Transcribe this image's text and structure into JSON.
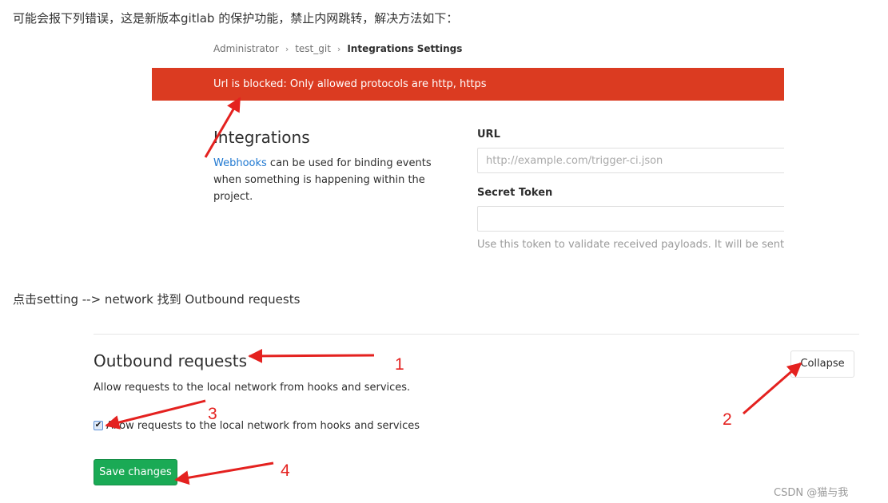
{
  "intro_text": "可能会报下列错误，这是新版本gitlab 的保护功能，禁止内网跳转，解决方法如下：",
  "screenshot1": {
    "breadcrumb": [
      {
        "label": "Administrator"
      },
      {
        "label": "test_git"
      },
      {
        "label": "Integrations Settings"
      }
    ],
    "error_flash": "Url is blocked: Only allowed protocols are http, https",
    "integrations": {
      "title": "Integrations",
      "link": "Webhooks",
      "description": " can be used for binding events when something is happening within the project."
    },
    "url_label": "URL",
    "url_placeholder": "http://example.com/trigger-ci.json",
    "secret_label": "Secret Token",
    "secret_value": "",
    "secret_help": "Use this token to validate received payloads. It will be sent with"
  },
  "step_text": "点击setting --> network 找到 Outbound requests",
  "outbound": {
    "title": "Outbound requests",
    "description": "Allow requests to the local network from hooks and services.",
    "collapse_label": "Collapse",
    "checkbox_checked": true,
    "checkbox_label": "Allow requests to the local network from hooks and services",
    "save_label": "Save changes"
  },
  "annotations": {
    "arrow_color": "#e4211f",
    "labels": [
      "1",
      "2",
      "3",
      "4"
    ]
  },
  "watermark": "CSDN @猫与我",
  "colors": {
    "error": "#db3b21",
    "link": "#1f78d1",
    "success": "#1aaa55"
  }
}
